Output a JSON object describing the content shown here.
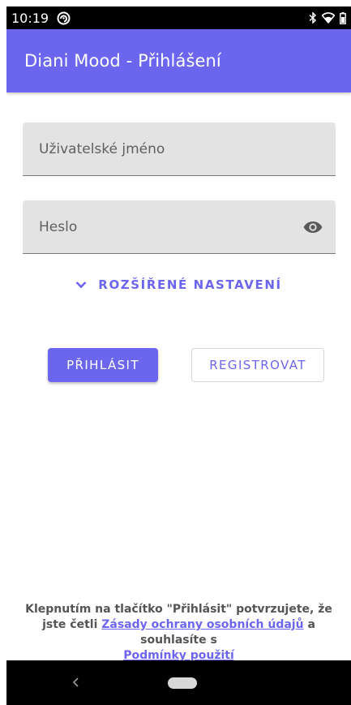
{
  "status_bar": {
    "time": "10:19",
    "icons": [
      "notification-icon",
      "bluetooth-icon",
      "wifi-icon",
      "battery-icon"
    ]
  },
  "app_bar": {
    "title": "Diani Mood - Přihlášení"
  },
  "form": {
    "username_placeholder": "Uživatelské jméno",
    "username_value": "",
    "password_placeholder": "Heslo",
    "password_value": "",
    "password_toggle_icon": "eye-icon",
    "advanced_label": "ROZŠÍŘENÉ NASTAVENÍ",
    "advanced_icon": "chevron-down-icon"
  },
  "buttons": {
    "login_label": "PŘIHLÁSIT",
    "register_label": "REGISTROVAT"
  },
  "consent": {
    "text_part1": "Klepnutím na tlačítko \"Přihlásit\" potvrzujete, že jste četli",
    "privacy_link": "Zásady ochrany osobních údajů",
    "text_part2": "a souhlasíte s",
    "terms_link": "Podmínky použití"
  },
  "nav_bar": {
    "icons": [
      "back-icon",
      "home-pill"
    ]
  },
  "colors": {
    "accent": "#6c66ef",
    "field_bg": "#e3e3e3",
    "status_bar": "#000000"
  }
}
